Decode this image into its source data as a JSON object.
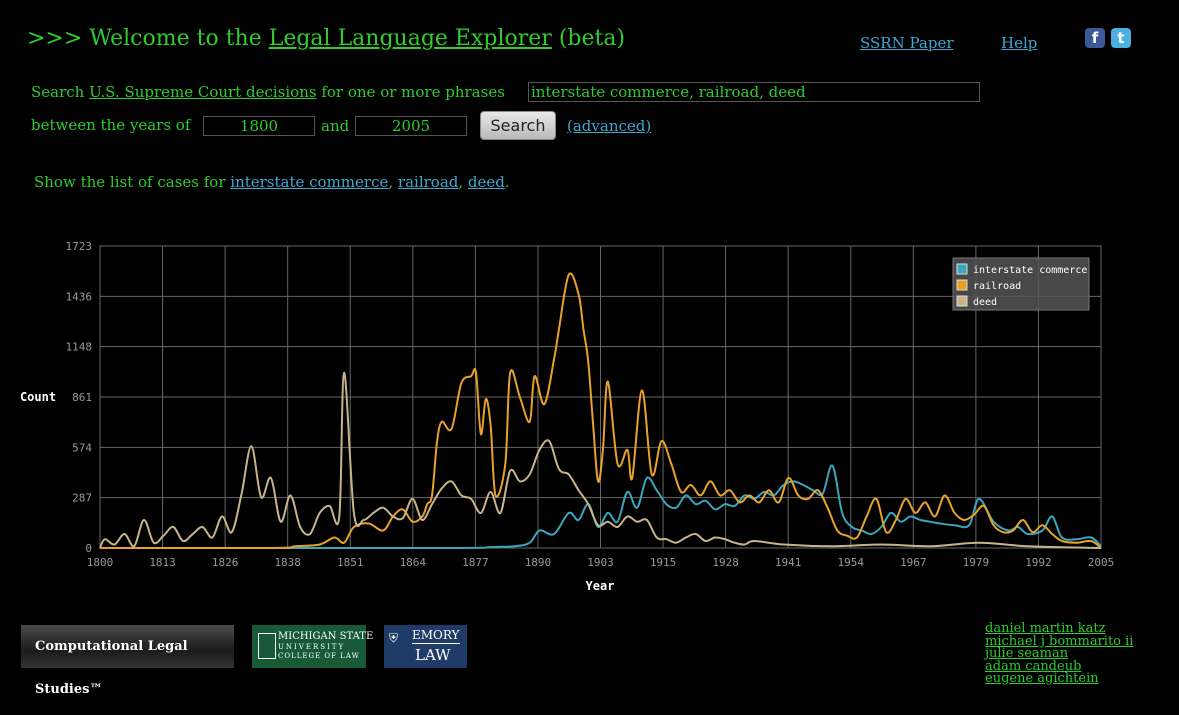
{
  "header": {
    "title_prefix": ">>> Welcome to the ",
    "title_link": "Legal Language Explorer",
    "title_suffix": " (beta)",
    "ssrn_link": "SSRN Paper",
    "help_link": "Help",
    "facebook_icon": "f",
    "twitter_icon": "t"
  },
  "search": {
    "prefix": "Search ",
    "source_link": "U.S. Supreme Court decisions",
    "mid_text": " for one or more phrases",
    "phrases_value": "interstate commerce, railroad, deed",
    "years_label": "between the years of",
    "year_from": "1800",
    "and_label": "and",
    "year_to": "2005",
    "button_label": "Search",
    "advanced_link": "(advanced)"
  },
  "cases": {
    "prefix": "Show the list of cases for ",
    "links": [
      "interstate commerce",
      "railroad",
      "deed"
    ],
    "sep": ", ",
    "end": "."
  },
  "chart_data": {
    "type": "line",
    "xlabel": "Year",
    "ylabel": "Count",
    "xlim": [
      1800,
      2005
    ],
    "ylim": [
      0,
      1723
    ],
    "x_ticks": [
      "1800",
      "1813",
      "1826",
      "1838",
      "1851",
      "1864",
      "1877",
      "1890",
      "1903",
      "1915",
      "1928",
      "1941",
      "1954",
      "1967",
      "1979",
      "1992",
      "2005"
    ],
    "y_ticks": [
      "0",
      "287",
      "574",
      "861",
      "1148",
      "1436",
      "1723"
    ],
    "grid": true,
    "legend_position": "top-right",
    "series": [
      {
        "name": "interstate commerce",
        "color": "#3aa6be",
        "points": [
          [
            1800,
            0
          ],
          [
            1870,
            0
          ],
          [
            1880,
            5
          ],
          [
            1885,
            10
          ],
          [
            1888,
            30
          ],
          [
            1890,
            100
          ],
          [
            1893,
            80
          ],
          [
            1896,
            200
          ],
          [
            1898,
            160
          ],
          [
            1900,
            250
          ],
          [
            1902,
            120
          ],
          [
            1904,
            200
          ],
          [
            1906,
            150
          ],
          [
            1908,
            320
          ],
          [
            1910,
            230
          ],
          [
            1912,
            400
          ],
          [
            1914,
            330
          ],
          [
            1916,
            250
          ],
          [
            1918,
            230
          ],
          [
            1920,
            300
          ],
          [
            1922,
            250
          ],
          [
            1924,
            270
          ],
          [
            1926,
            220
          ],
          [
            1928,
            250
          ],
          [
            1930,
            240
          ],
          [
            1932,
            300
          ],
          [
            1934,
            280
          ],
          [
            1936,
            320
          ],
          [
            1938,
            300
          ],
          [
            1940,
            360
          ],
          [
            1942,
            380
          ],
          [
            1944,
            360
          ],
          [
            1946,
            330
          ],
          [
            1948,
            310
          ],
          [
            1950,
            470
          ],
          [
            1952,
            200
          ],
          [
            1954,
            120
          ],
          [
            1956,
            100
          ],
          [
            1958,
            80
          ],
          [
            1960,
            120
          ],
          [
            1962,
            200
          ],
          [
            1964,
            150
          ],
          [
            1966,
            180
          ],
          [
            1968,
            160
          ],
          [
            1970,
            150
          ],
          [
            1972,
            140
          ],
          [
            1975,
            130
          ],
          [
            1978,
            130
          ],
          [
            1980,
            280
          ],
          [
            1983,
            150
          ],
          [
            1986,
            100
          ],
          [
            1988,
            120
          ],
          [
            1990,
            80
          ],
          [
            1993,
            100
          ],
          [
            1995,
            180
          ],
          [
            1997,
            60
          ],
          [
            2000,
            50
          ],
          [
            2003,
            60
          ],
          [
            2005,
            10
          ]
        ]
      },
      {
        "name": "railroad",
        "color": "#e8a22a",
        "points": [
          [
            1800,
            0
          ],
          [
            1835,
            0
          ],
          [
            1840,
            10
          ],
          [
            1845,
            20
          ],
          [
            1848,
            60
          ],
          [
            1850,
            30
          ],
          [
            1852,
            120
          ],
          [
            1855,
            140
          ],
          [
            1858,
            100
          ],
          [
            1860,
            180
          ],
          [
            1862,
            220
          ],
          [
            1864,
            150
          ],
          [
            1866,
            180
          ],
          [
            1867,
            250
          ],
          [
            1868,
            300
          ],
          [
            1869,
            600
          ],
          [
            1870,
            720
          ],
          [
            1872,
            680
          ],
          [
            1874,
            940
          ],
          [
            1876,
            980
          ],
          [
            1877,
            1000
          ],
          [
            1878,
            650
          ],
          [
            1879,
            850
          ],
          [
            1880,
            700
          ],
          [
            1881,
            300
          ],
          [
            1883,
            480
          ],
          [
            1884,
            1000
          ],
          [
            1886,
            860
          ],
          [
            1888,
            720
          ],
          [
            1889,
            980
          ],
          [
            1891,
            820
          ],
          [
            1893,
            1080
          ],
          [
            1894,
            1250
          ],
          [
            1896,
            1560
          ],
          [
            1898,
            1450
          ],
          [
            1899,
            1250
          ],
          [
            1900,
            1060
          ],
          [
            1901,
            700
          ],
          [
            1902,
            380
          ],
          [
            1903,
            560
          ],
          [
            1904,
            950
          ],
          [
            1906,
            480
          ],
          [
            1908,
            560
          ],
          [
            1909,
            400
          ],
          [
            1911,
            900
          ],
          [
            1913,
            420
          ],
          [
            1915,
            610
          ],
          [
            1917,
            480
          ],
          [
            1919,
            320
          ],
          [
            1921,
            360
          ],
          [
            1923,
            300
          ],
          [
            1925,
            380
          ],
          [
            1927,
            300
          ],
          [
            1929,
            330
          ],
          [
            1931,
            260
          ],
          [
            1933,
            300
          ],
          [
            1935,
            260
          ],
          [
            1937,
            330
          ],
          [
            1939,
            260
          ],
          [
            1941,
            400
          ],
          [
            1943,
            300
          ],
          [
            1945,
            280
          ],
          [
            1947,
            330
          ],
          [
            1949,
            230
          ],
          [
            1951,
            100
          ],
          [
            1953,
            70
          ],
          [
            1955,
            60
          ],
          [
            1957,
            180
          ],
          [
            1959,
            280
          ],
          [
            1961,
            90
          ],
          [
            1963,
            160
          ],
          [
            1965,
            280
          ],
          [
            1967,
            200
          ],
          [
            1969,
            260
          ],
          [
            1971,
            180
          ],
          [
            1973,
            300
          ],
          [
            1975,
            200
          ],
          [
            1977,
            160
          ],
          [
            1979,
            190
          ],
          [
            1981,
            240
          ],
          [
            1983,
            130
          ],
          [
            1985,
            90
          ],
          [
            1987,
            100
          ],
          [
            1989,
            160
          ],
          [
            1991,
            90
          ],
          [
            1993,
            130
          ],
          [
            1995,
            80
          ],
          [
            1997,
            40
          ],
          [
            2000,
            30
          ],
          [
            2003,
            40
          ],
          [
            2005,
            0
          ]
        ]
      },
      {
        "name": "deed",
        "color": "#c9b48a",
        "points": [
          [
            1800,
            0
          ],
          [
            1801,
            50
          ],
          [
            1803,
            20
          ],
          [
            1805,
            80
          ],
          [
            1807,
            10
          ],
          [
            1809,
            160
          ],
          [
            1811,
            30
          ],
          [
            1813,
            70
          ],
          [
            1815,
            120
          ],
          [
            1817,
            40
          ],
          [
            1819,
            80
          ],
          [
            1821,
            120
          ],
          [
            1823,
            60
          ],
          [
            1825,
            180
          ],
          [
            1827,
            90
          ],
          [
            1829,
            310
          ],
          [
            1831,
            580
          ],
          [
            1833,
            290
          ],
          [
            1835,
            400
          ],
          [
            1837,
            150
          ],
          [
            1839,
            300
          ],
          [
            1841,
            120
          ],
          [
            1843,
            80
          ],
          [
            1845,
            200
          ],
          [
            1847,
            240
          ],
          [
            1849,
            180
          ],
          [
            1850,
            1000
          ],
          [
            1852,
            200
          ],
          [
            1854,
            160
          ],
          [
            1856,
            200
          ],
          [
            1858,
            230
          ],
          [
            1860,
            180
          ],
          [
            1862,
            170
          ],
          [
            1864,
            280
          ],
          [
            1866,
            160
          ],
          [
            1868,
            250
          ],
          [
            1870,
            340
          ],
          [
            1872,
            380
          ],
          [
            1874,
            300
          ],
          [
            1876,
            280
          ],
          [
            1878,
            200
          ],
          [
            1880,
            320
          ],
          [
            1882,
            200
          ],
          [
            1884,
            440
          ],
          [
            1886,
            380
          ],
          [
            1888,
            420
          ],
          [
            1890,
            560
          ],
          [
            1892,
            610
          ],
          [
            1894,
            450
          ],
          [
            1896,
            420
          ],
          [
            1898,
            330
          ],
          [
            1900,
            250
          ],
          [
            1902,
            130
          ],
          [
            1904,
            150
          ],
          [
            1906,
            120
          ],
          [
            1908,
            180
          ],
          [
            1910,
            150
          ],
          [
            1912,
            160
          ],
          [
            1914,
            60
          ],
          [
            1916,
            50
          ],
          [
            1918,
            30
          ],
          [
            1920,
            60
          ],
          [
            1922,
            80
          ],
          [
            1924,
            40
          ],
          [
            1926,
            60
          ],
          [
            1928,
            50
          ],
          [
            1930,
            30
          ],
          [
            1932,
            20
          ],
          [
            1934,
            40
          ],
          [
            1940,
            20
          ],
          [
            1950,
            10
          ],
          [
            1960,
            20
          ],
          [
            1970,
            10
          ],
          [
            1980,
            30
          ],
          [
            1990,
            10
          ],
          [
            2005,
            0
          ]
        ]
      }
    ]
  },
  "footer": {
    "cls_logo": "Computational Legal Studies™",
    "msu_logo_line1": "MICHIGAN STATE",
    "msu_logo_line2": "UNIVERSITY",
    "msu_logo_line3": "COLLEGE OF LAW",
    "emory_logo_line1": "EMORY",
    "emory_logo_line2": "LAW",
    "authors": [
      "daniel martin katz",
      "michael j bommarito ii",
      "julie seaman",
      "adam candeub",
      "eugene agichtein"
    ]
  }
}
